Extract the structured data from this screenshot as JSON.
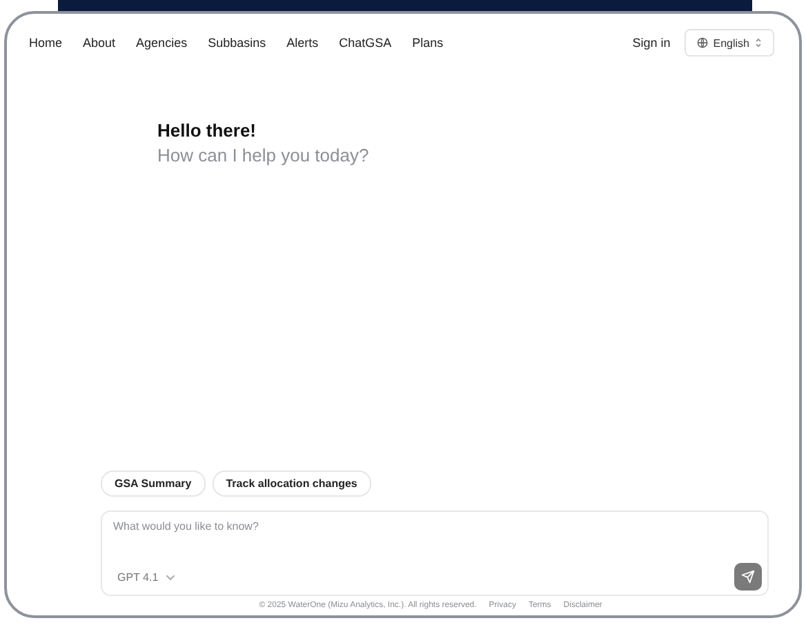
{
  "nav": {
    "links": [
      {
        "label": "Home"
      },
      {
        "label": "About"
      },
      {
        "label": "Agencies"
      },
      {
        "label": "Subbasins"
      },
      {
        "label": "Alerts"
      },
      {
        "label": "ChatGSA"
      },
      {
        "label": "Plans"
      }
    ],
    "sign_in": "Sign in",
    "language": "English"
  },
  "greeting": {
    "title": "Hello there!",
    "subtitle": "How can I help you today?"
  },
  "suggestions": [
    {
      "label": "GSA Summary"
    },
    {
      "label": "Track allocation changes"
    }
  ],
  "composer": {
    "placeholder": "What would you like to know?",
    "model": "GPT 4.1"
  },
  "footer": {
    "copyright": "© 2025 WaterOne (Mizu Analytics, Inc.). All rights reserved.",
    "links": [
      {
        "label": "Privacy"
      },
      {
        "label": "Terms"
      },
      {
        "label": "Disclaimer"
      }
    ]
  }
}
